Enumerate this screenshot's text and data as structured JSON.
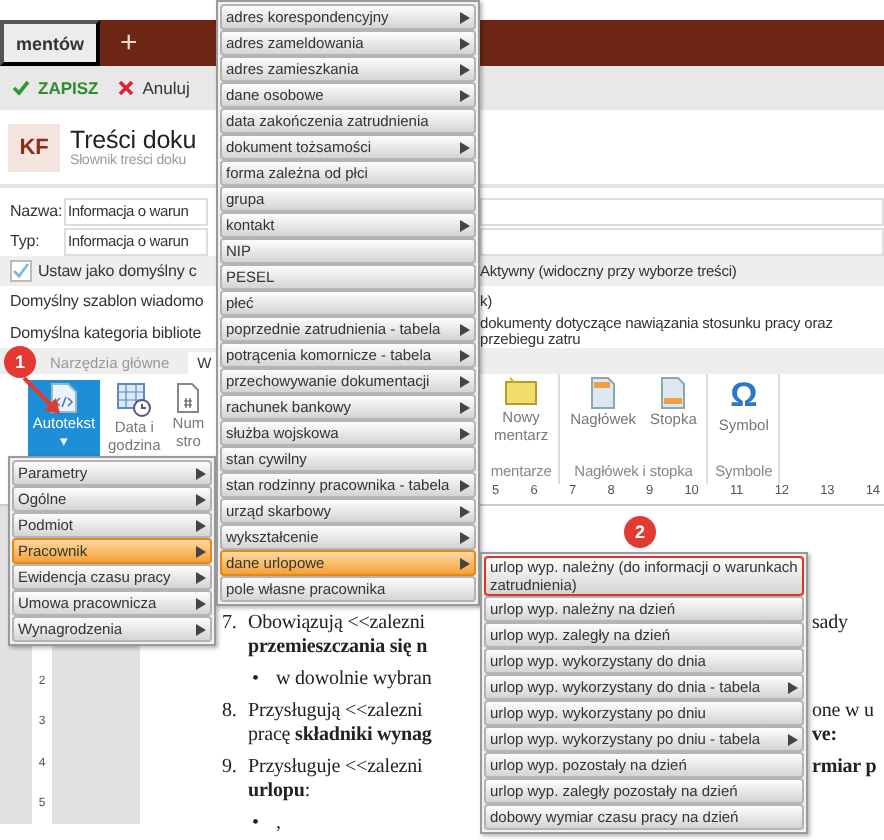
{
  "tabs": [
    {
      "label": "mentów",
      "selected": true
    }
  ],
  "new_tab": "+",
  "toolbar": [
    {
      "kind": "save",
      "label": "ZAPISZ"
    },
    {
      "kind": "cancel",
      "label": "Anuluj"
    }
  ],
  "header": {
    "badge": "KF",
    "title": "Treści doku",
    "subtitle": "Słownik treści doku"
  },
  "form": [
    {
      "kind": "field",
      "label": "Nazwa:",
      "value": "Informacja o warun"
    },
    {
      "kind": "field",
      "label": "Typ:",
      "value": "Informacja o warun"
    },
    {
      "kind": "checkbox",
      "label": "Ustaw jako domyślny c",
      "checked": true,
      "right": "Aktywny (widoczny przy wyborze treści)"
    },
    {
      "kind": "text",
      "label": "Domyślny szablon wiadomo",
      "right": "k)"
    },
    {
      "kind": "text",
      "label": "Domyślna kategoria bibliote",
      "right": "dokumenty dotyczące nawiązania stosunku pracy oraz przebiegu zatru"
    }
  ],
  "ribbon_tabs": [
    {
      "label": "Narzędzia główne",
      "selected": false
    },
    {
      "label": "W",
      "selected": true
    }
  ],
  "ribbon_left": [
    {
      "kind": "autotext",
      "lines": [
        "Autotekst",
        "▾"
      ],
      "selected": true
    },
    {
      "kind": "datetime",
      "lines": [
        "Data i",
        "godzina"
      ],
      "selected": false
    },
    {
      "kind": "pagenum",
      "lines": [
        "Num",
        "stro"
      ],
      "selected": false
    }
  ],
  "ribbon_groups": [
    {
      "label": "mentarze",
      "buttons": [
        {
          "kind": "comment",
          "lines": [
            "Nowy",
            "mentarz"
          ]
        }
      ]
    },
    {
      "label": "Nagłówek i stopka",
      "buttons": [
        {
          "kind": "header",
          "lines": [
            "Nagłówek"
          ]
        },
        {
          "kind": "footer",
          "lines": [
            "Stopka"
          ]
        }
      ]
    },
    {
      "label": "Symbole",
      "buttons": [
        {
          "kind": "symbol",
          "glyph": "Ω",
          "lines": [
            "Symbol"
          ]
        }
      ]
    }
  ],
  "ruler": [
    "5",
    "6",
    "7",
    "8",
    "9",
    "10",
    "11",
    "12",
    "13",
    "14"
  ],
  "vruler": [
    "2",
    "3",
    "4",
    "5"
  ],
  "document": [
    {
      "kind": "item",
      "marker": "7.",
      "text": "Obowiązują <<zalezni",
      "right": "sady"
    },
    {
      "kind": "cont",
      "text": "**przemieszczania się n**"
    },
    {
      "kind": "bullet",
      "marker": "•",
      "text": "w dowolnie wybran"
    },
    {
      "kind": "item",
      "marker": "8.",
      "text": "Przysługują <<zalezni",
      "right": "one w u"
    },
    {
      "kind": "cont",
      "text": "pracę **składniki wynag**",
      "right": "**ve:**"
    },
    {
      "kind": "item",
      "marker": "9.",
      "text": "Przysługuje <<zalezni",
      "right": "**rmiar p**"
    },
    {
      "kind": "cont",
      "text": "**urlopu**:"
    },
    {
      "kind": "bullet",
      "marker": "•",
      "text": ","
    }
  ],
  "menus": [
    {
      "items": [
        {
          "label": "Parametry",
          "submenu": true,
          "selected": false
        },
        {
          "label": "Ogólne",
          "submenu": true,
          "selected": false
        },
        {
          "label": "Podmiot",
          "submenu": true,
          "selected": false
        },
        {
          "label": "Pracownik",
          "submenu": true,
          "selected": true
        },
        {
          "label": "Ewidencja czasu pracy",
          "submenu": true,
          "selected": false
        },
        {
          "label": "Umowa pracownicza",
          "submenu": true,
          "selected": false
        },
        {
          "label": "Wynagrodzenia",
          "submenu": true,
          "selected": false
        }
      ]
    },
    {
      "items": [
        {
          "label": "adres korespondencyjny",
          "submenu": true,
          "selected": false
        },
        {
          "label": "adres zameldowania",
          "submenu": true,
          "selected": false
        },
        {
          "label": "adres zamieszkania",
          "submenu": true,
          "selected": false
        },
        {
          "label": "dane osobowe",
          "submenu": true,
          "selected": false
        },
        {
          "label": "data zakończenia zatrudnienia",
          "submenu": false,
          "selected": false
        },
        {
          "label": "dokument tożsamości",
          "submenu": true,
          "selected": false
        },
        {
          "label": "forma zależna od płci",
          "submenu": false,
          "selected": false
        },
        {
          "label": "grupa",
          "submenu": false,
          "selected": false
        },
        {
          "label": "kontakt",
          "submenu": true,
          "selected": false
        },
        {
          "label": "NIP",
          "submenu": false,
          "selected": false
        },
        {
          "label": "PESEL",
          "submenu": false,
          "selected": false
        },
        {
          "label": "płeć",
          "submenu": false,
          "selected": false
        },
        {
          "label": "poprzednie zatrudnienia - tabela",
          "submenu": true,
          "selected": false
        },
        {
          "label": "potrącenia komornicze - tabela",
          "submenu": true,
          "selected": false
        },
        {
          "label": "przechowywanie dokumentacji",
          "submenu": true,
          "selected": false
        },
        {
          "label": "rachunek bankowy",
          "submenu": true,
          "selected": false
        },
        {
          "label": "służba wojskowa",
          "submenu": true,
          "selected": false
        },
        {
          "label": "stan cywilny",
          "submenu": false,
          "selected": false
        },
        {
          "label": "stan rodzinny pracownika - tabela",
          "submenu": true,
          "selected": false
        },
        {
          "label": "urząd skarbowy",
          "submenu": true,
          "selected": false
        },
        {
          "label": "wykształcenie",
          "submenu": true,
          "selected": false
        },
        {
          "label": "dane urlopowe",
          "submenu": true,
          "selected": true
        },
        {
          "label": "pole własne pracownika",
          "submenu": false,
          "selected": false
        }
      ]
    },
    {
      "items": [
        {
          "label": "urlop wyp. należny (do informacji o warunkach zatrudnienia)",
          "submenu": false,
          "selected": false,
          "outlined": true
        },
        {
          "label": "urlop wyp. należny na dzień",
          "submenu": false,
          "selected": false,
          "outlined": false
        },
        {
          "label": "urlop wyp. zaległy na dzień",
          "submenu": false,
          "selected": false,
          "outlined": false
        },
        {
          "label": "urlop wyp. wykorzystany do dnia",
          "submenu": false,
          "selected": false,
          "outlined": false
        },
        {
          "label": "urlop wyp. wykorzystany do dnia - tabela",
          "submenu": true,
          "selected": false,
          "outlined": false
        },
        {
          "label": "urlop wyp. wykorzystany po dniu",
          "submenu": false,
          "selected": false,
          "outlined": false
        },
        {
          "label": "urlop wyp. wykorzystany po dniu - tabela",
          "submenu": true,
          "selected": false,
          "outlined": false
        },
        {
          "label": "urlop wyp. pozostały na dzień",
          "submenu": false,
          "selected": false,
          "outlined": false
        },
        {
          "label": "urlop wyp. zaległy pozostały na dzień",
          "submenu": false,
          "selected": false,
          "outlined": false
        },
        {
          "label": "dobowy wymiar czasu pracy na dzień",
          "submenu": false,
          "selected": false,
          "outlined": false
        }
      ]
    }
  ],
  "steps": [
    {
      "label": "1"
    },
    {
      "label": "2"
    }
  ]
}
